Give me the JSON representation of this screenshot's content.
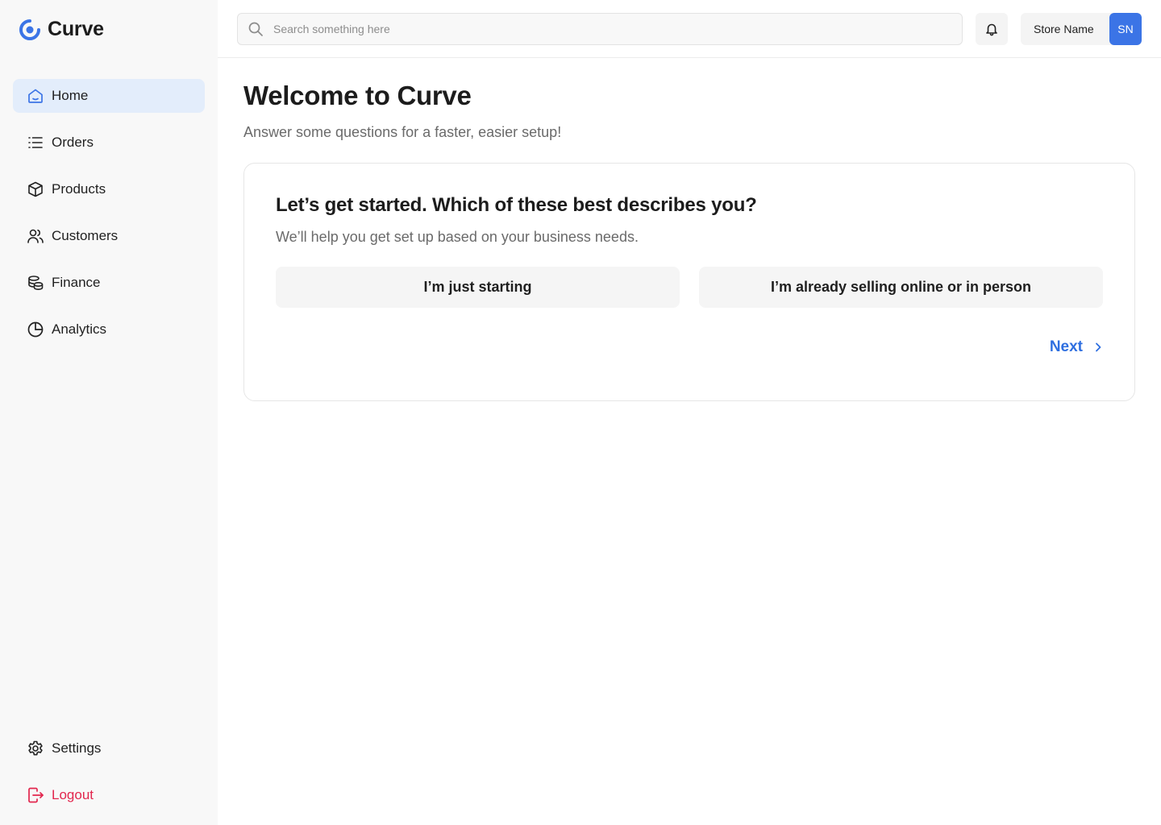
{
  "app": {
    "name": "Curve",
    "brand_color": "#3b74e6",
    "logout_color": "#e2264d"
  },
  "sidebar": {
    "items": [
      {
        "label": "Home",
        "icon": "home-icon",
        "active": true
      },
      {
        "label": "Orders",
        "icon": "list-icon",
        "active": false
      },
      {
        "label": "Products",
        "icon": "box-icon",
        "active": false
      },
      {
        "label": "Customers",
        "icon": "users-icon",
        "active": false
      },
      {
        "label": "Finance",
        "icon": "coins-icon",
        "active": false
      },
      {
        "label": "Analytics",
        "icon": "pie-chart-icon",
        "active": false
      }
    ],
    "bottom": [
      {
        "label": "Settings",
        "icon": "gear-icon"
      },
      {
        "label": "Logout",
        "icon": "logout-icon"
      }
    ]
  },
  "header": {
    "search": {
      "placeholder": "Search something here",
      "value": ""
    },
    "store_name": "Store Name",
    "avatar_initials": "SN"
  },
  "main": {
    "title": "Welcome to Curve",
    "subtitle": "Answer some questions for a faster, easier setup!",
    "card": {
      "title": "Let’s get started. Which of these best describes you?",
      "subtitle": "We’ll help you get set up based on your business needs.",
      "options": [
        "I’m just starting",
        "I’m already selling online or in person"
      ],
      "next_label": "Next"
    }
  }
}
